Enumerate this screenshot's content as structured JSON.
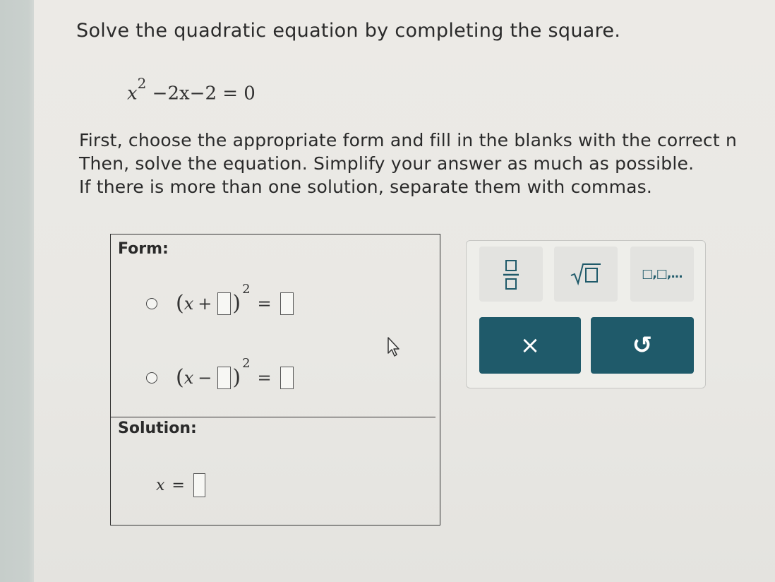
{
  "problem": {
    "title": "Solve the quadratic equation by completing the square.",
    "equation": {
      "var": "x",
      "exponent": "2",
      "rest": "−2x−2 = 0"
    },
    "instructions": [
      "First, choose the appropriate form and fill in the blanks with the correct n",
      "Then, solve the equation. Simplify your answer as much as possible.",
      "If there is more than one solution, separate them with commas."
    ]
  },
  "form": {
    "label": "Form:",
    "options": [
      {
        "lparen": "(",
        "var": "x",
        "op": "+",
        "rparen": ")",
        "exp": "2",
        "eq": "="
      },
      {
        "lparen": "(",
        "var": "x",
        "op": "−",
        "rparen": ")",
        "exp": "2",
        "eq": "="
      }
    ]
  },
  "solution": {
    "label": "Solution:",
    "var": "x",
    "eq": "="
  },
  "toolbar": {
    "tools": [
      "fraction-icon",
      "square-root-icon",
      "list-separator-icon"
    ],
    "list_label": "□,□,...",
    "clear_label": "×",
    "undo_label": "↺"
  }
}
